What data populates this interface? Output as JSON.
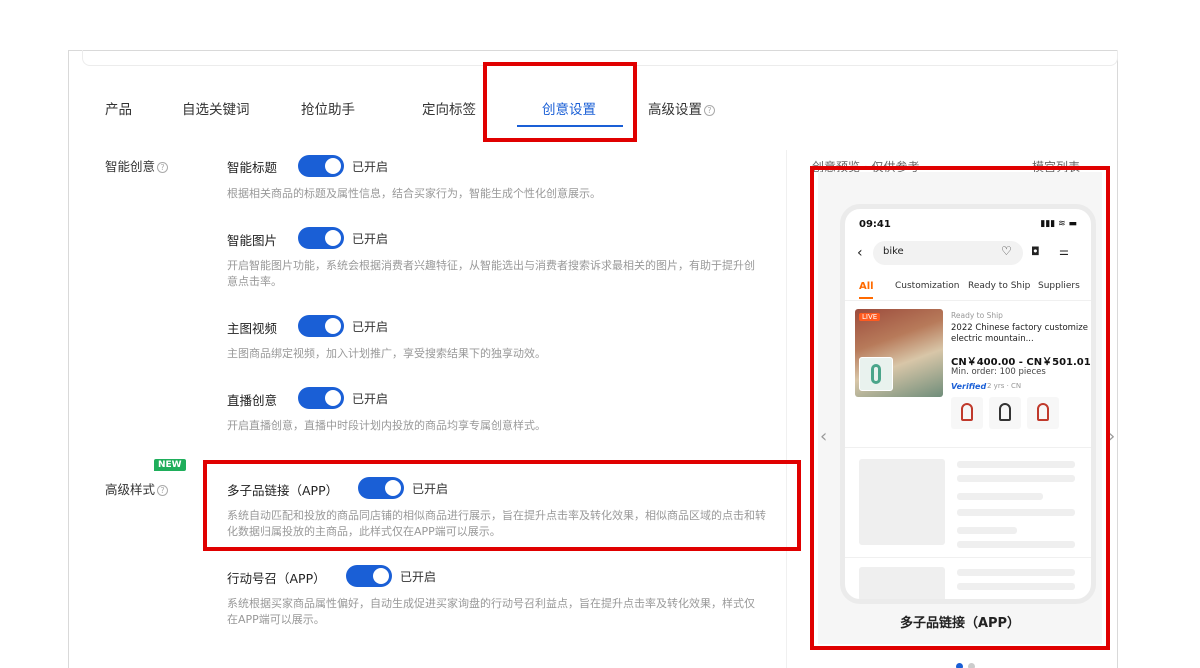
{
  "tabs": [
    {
      "label": "产品"
    },
    {
      "label": "自选关键词"
    },
    {
      "label": "抢位助手"
    },
    {
      "label": "定向标签"
    },
    {
      "label": "创意设置"
    },
    {
      "label": "高级设置"
    }
  ],
  "sections": {
    "smart": "智能创意",
    "advanced": "高级样式",
    "new_badge": "NEW"
  },
  "settings": [
    {
      "name": "智能标题",
      "status": "已开启",
      "desc": "根据相关商品的标题及属性信息，结合买家行为，智能生成个性化创意展示。"
    },
    {
      "name": "智能图片",
      "status": "已开启",
      "desc": "开启智能图片功能，系统会根据消费者兴趣特征，从智能选出与消费者搜索诉求最相关的图片，有助于提升创意点击率。"
    },
    {
      "name": "主图视频",
      "status": "已开启",
      "desc": "主图商品绑定视频，加入计划推广，享受搜索结果下的独享动效。"
    },
    {
      "name": "直播创意",
      "status": "已开启",
      "desc": "开启直播创意，直播中时段计划内投放的商品均享专属创意样式。"
    },
    {
      "name": "多子品链接（APP）",
      "status": "已开启",
      "desc": "系统自动匹配和投放的商品同店铺的相似商品进行展示，旨在提升点击率及转化效果，相似商品区域的点击和转化数据归属投放的主商品，此样式仅在APP端可以展示。"
    },
    {
      "name": "行动号召（APP）",
      "status": "已开启",
      "desc": "系统根据买家商品属性偏好，自动生成促进买家询盘的行动号召利益点，旨在提升点击率及转化效果，样式仅在APP端可以展示。"
    }
  ],
  "preview": {
    "head_left": "创意预览 · 仅供参考",
    "head_right": "模宫列表",
    "caption": "多子品链接（APP）",
    "phone": {
      "time": "09:41",
      "status": "▮▮▮ ≋ ▬",
      "search": "bike",
      "categories": [
        "All",
        "Customization",
        "Ready to Ship",
        "Suppliers"
      ],
      "product": {
        "live": "LIVE",
        "tag": "Ready to Ship",
        "title": "2022 Chinese factory customize electric mountain...",
        "price": "CN￥400.00 - CN￥501.01",
        "moq": "Min. order: 100 pieces",
        "verified": "Verified",
        "meta": "2 yrs · CN"
      }
    }
  },
  "icons": {
    "help": "?",
    "back": "‹",
    "heart": "♡",
    "camera": "◘",
    "filter": "⚌",
    "prev": "‹",
    "next": "›"
  },
  "colors": {
    "accent": "#1a5fd6",
    "highlight": "#e00000",
    "orange": "#ff6a00",
    "new_badge": "#1fae5b"
  }
}
